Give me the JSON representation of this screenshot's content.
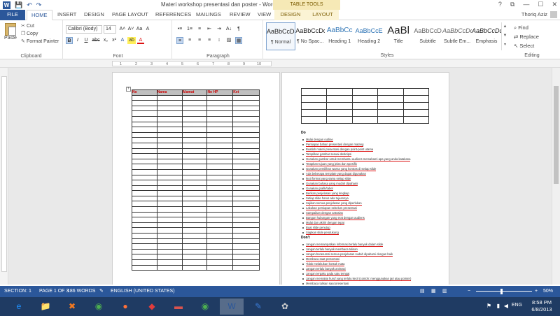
{
  "colors": {
    "accent": "#2b579a",
    "context_tab_bg": "#f6e9b6",
    "spelling_underline": "#d11",
    "taskbar": "#1f3b63"
  },
  "title_bar": {
    "document_title": "Materi workshop presentasi dan poster - Word",
    "context_group": "TABLE TOOLS",
    "help": "?",
    "restore_ribbon": "⧉",
    "minimize": "—",
    "maximize": "☐",
    "close": "✕",
    "quick_access": {
      "save": "💾",
      "undo": "↶",
      "redo": "↷"
    }
  },
  "tabs": [
    {
      "label": "FILE"
    },
    {
      "label": "HOME"
    },
    {
      "label": "INSERT"
    },
    {
      "label": "DESIGN"
    },
    {
      "label": "PAGE LAYOUT"
    },
    {
      "label": "REFERENCES"
    },
    {
      "label": "MAILINGS"
    },
    {
      "label": "REVIEW"
    },
    {
      "label": "VIEW"
    },
    {
      "label": "DESIGN"
    },
    {
      "label": "LAYOUT"
    }
  ],
  "user": {
    "name": "Thoriq Aziz"
  },
  "ribbon": {
    "clipboard": {
      "label": "Clipboard",
      "paste": "Paste",
      "cut": "Cut",
      "copy": "Copy",
      "format_painter": "Format Painter"
    },
    "font": {
      "label": "Font",
      "font_name": "Calibri (Body)",
      "font_size": "14",
      "grow": "A˄",
      "shrink": "A˅",
      "case": "Aa",
      "clear": "A",
      "bold": "B",
      "italic": "I",
      "underline": "U",
      "strike": "abc",
      "subscript": "x₂",
      "superscript": "x²",
      "effects": "A",
      "highlight": "ab",
      "font_color": "A"
    },
    "paragraph": {
      "label": "Paragraph",
      "bullets": "•≡",
      "numbering": "1≡",
      "multilevel": "≡",
      "decrease_indent": "⇤",
      "increase_indent": "⇥",
      "sort": "A↓",
      "show_marks": "¶",
      "align_left": "≡",
      "center": "≡",
      "align_right": "≡",
      "justify": "≡",
      "line_spacing": "↕",
      "shading": "▨",
      "borders": "▦"
    },
    "styles": {
      "label": "Styles",
      "items": [
        {
          "sample": "AaBbCcDc",
          "name": "¶ Normal"
        },
        {
          "sample": "AaBbCcDc",
          "name": "¶ No Spac..."
        },
        {
          "sample": "AaBbCc",
          "name": "Heading 1"
        },
        {
          "sample": "AaBbCcE",
          "name": "Heading 2"
        },
        {
          "sample": "AaBl",
          "name": "Title"
        },
        {
          "sample": "AaBbCcD",
          "name": "Subtitle"
        },
        {
          "sample": "AaBbCcDc",
          "name": "Subtle Em..."
        },
        {
          "sample": "AaBbCcDc",
          "name": "Emphasis"
        }
      ]
    },
    "editing": {
      "label": "Editing",
      "find": "Find",
      "replace": "Replace",
      "select": "Select"
    }
  },
  "ruler": {
    "numbers": [
      "1",
      "2",
      "3",
      "4",
      "5",
      "6",
      "7",
      "8",
      "9",
      "10"
    ]
  },
  "page1": {
    "table_header": [
      "No",
      "Nama",
      "Alamat",
      "No HP",
      "Ket"
    ],
    "row_count": 33
  },
  "page2": {
    "row_count": 5,
    "do_heading": "Do",
    "do_items": [
      "Mulai dengan outline",
      "Persiapan bahan presentasi dengan matang",
      "Buatlah materi presentasi dengan point-point utama",
      "Tampilkan gambar sesuai deskripsi",
      "Gunakan gambar untuk membantu audiens memahami apa yang anda katakana",
      "Tetapkan tujuan yang jelas dan spesifik",
      "Gunakan pemilihan warna yang kontras di setiap slide",
      "Ada beberapa template yang dapat digunakan",
      "Ikuti format yang sama setiap slide",
      "Gunakan bahasa yang mudah dipahami",
      "Gunakan grafik/tabel",
      "Berikan penjelasan yang lengkap",
      "Setiap slide harus ada tujuannya",
      "Sajikan semua penjelasan yang diperlukan",
      "Lakukan persiapan sebelum presentasi",
      "Sampaikan dengan antusias",
      "Bangun hubungan yang erat dengan audiens",
      "Mulai dan akhiri dengan tepat",
      "Buat slide penutup",
      "Siapkan slide pendukung"
    ],
    "dont_heading": "Don't",
    "dont_items": [
      "Jangan memampatkan informasi terlalu banyak dalam slide",
      "Jangan terlalu banyak membaca tulisan",
      "Jangan berasumsi semua penjelasan sudah dipahami dengan baik",
      "Membaca saat presentasi",
      "Tidak melakukan kontak mata",
      "Jangan terlalu banyak animasi",
      "Jangan terpaku pada satu tempat",
      "Jangan memakai huruf yang terlalu kecil (contoh: menggunakan jari atau pointer)",
      "Membaca tulisan saat presentasi",
      "Membaca slide presentasi"
    ]
  },
  "status_bar": {
    "section": "SECTION: 1",
    "page": "PAGE 1 OF 3",
    "words": "186 WORDS",
    "language": "ENGLISH (UNITED STATES)",
    "zoom": "50%",
    "zoom_minus": "−",
    "zoom_plus": "+"
  },
  "taskbar": {
    "apps": [
      {
        "icon": "ie-icon",
        "glyph": "e"
      },
      {
        "icon": "explorer-icon",
        "glyph": "📁"
      },
      {
        "icon": "xampp-icon",
        "glyph": "✖"
      },
      {
        "icon": "chrome-icon",
        "glyph": "◉"
      },
      {
        "icon": "firefox-icon",
        "glyph": "●"
      },
      {
        "icon": "app-icon",
        "glyph": "◆"
      },
      {
        "icon": "book-icon",
        "glyph": "▬"
      },
      {
        "icon": "chrome-icon-2",
        "glyph": "◉"
      },
      {
        "icon": "word-icon",
        "glyph": "W"
      },
      {
        "icon": "tool-icon",
        "glyph": "✎"
      },
      {
        "icon": "paint-icon",
        "glyph": "✿"
      }
    ],
    "language": "ENG",
    "time": "8:58 PM",
    "date": "6/8/2013"
  }
}
